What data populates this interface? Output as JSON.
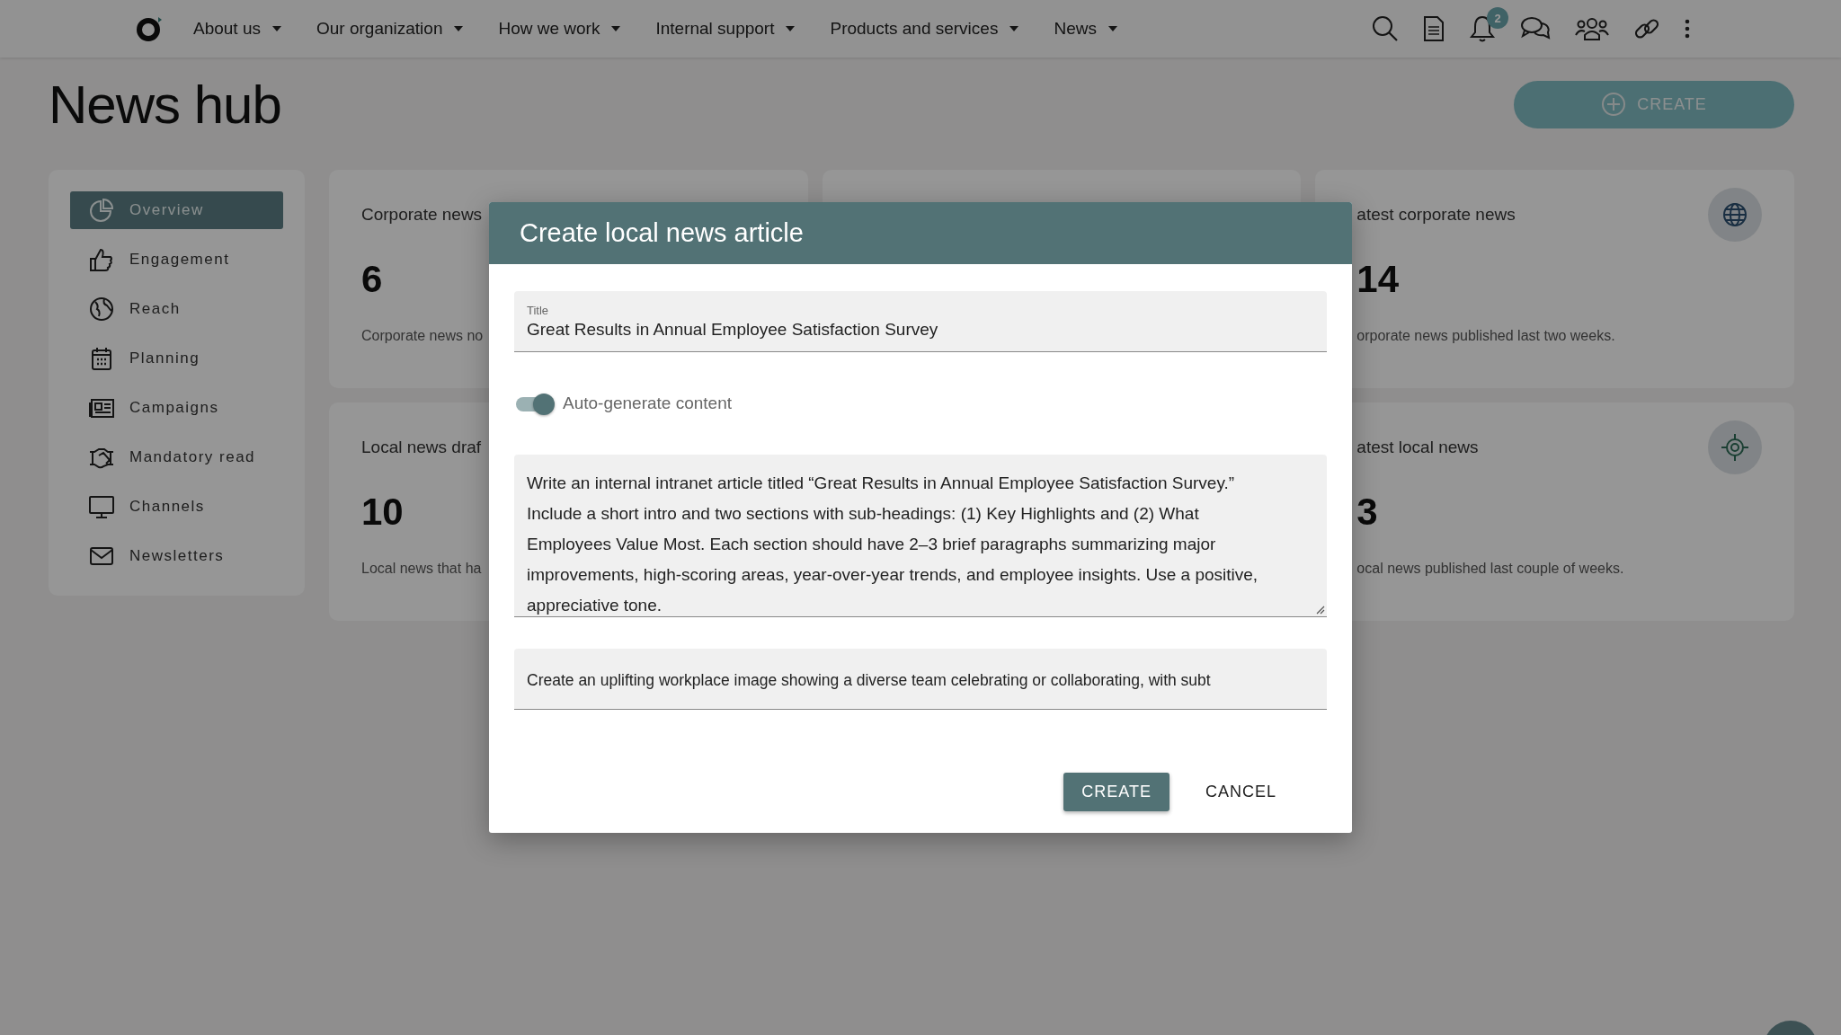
{
  "top_nav": {
    "menus": [
      {
        "label": "About us"
      },
      {
        "label": "Our organization"
      },
      {
        "label": "How we work"
      },
      {
        "label": "Internal support"
      },
      {
        "label": "Products and services"
      },
      {
        "label": "News"
      }
    ],
    "notification_count": "2"
  },
  "page_title": "News hub",
  "create_button": "CREATE",
  "sidebar": {
    "items": [
      {
        "label": "Overview",
        "selected": true
      },
      {
        "label": "Engagement",
        "selected": false
      },
      {
        "label": "Reach",
        "selected": false
      },
      {
        "label": "Planning",
        "selected": false
      },
      {
        "label": "Campaigns",
        "selected": false
      },
      {
        "label": "Mandatory read",
        "selected": false
      },
      {
        "label": "Channels",
        "selected": false
      },
      {
        "label": "Newsletters",
        "selected": false
      }
    ]
  },
  "cards": [
    {
      "kind": "left",
      "title": "Corporate news",
      "value": "6",
      "description": "Corporate news no"
    },
    {
      "kind": "blank"
    },
    {
      "kind": "right",
      "title": "atest corporate news",
      "value": "14",
      "description": "orporate news published last two weeks."
    },
    {
      "kind": "left",
      "title": "Local news draf",
      "value": "10",
      "description": "Local news that ha"
    },
    {
      "kind": "right",
      "title": "atest local news",
      "value": "3",
      "description": "ocal news published last couple of weeks."
    }
  ],
  "dialog": {
    "title": "Create local news article",
    "title_field": {
      "label": "Title",
      "value": "Great Results in Annual Employee Satisfaction Survey"
    },
    "auto_generate": {
      "label": "Auto-generate content",
      "on": true
    },
    "content_prompt": {
      "value": "Write an internal intranet article titled “Great Results in Annual Employee Satisfaction Survey.” Include a short intro and two sections with sub-headings: (1) Key Highlights and (2) What Employees Value Most. Each section should have 2–3 brief paragraphs summarizing major improvements, high-scoring areas, year-over-year trends, and employee insights. Use a positive, appreciative tone."
    },
    "image_prompt": {
      "value": "Create an uplifting workplace image showing a diverse team celebrating or collaborating, with subt"
    },
    "buttons": [
      {
        "label": "CREATE",
        "kind": "primary"
      },
      {
        "label": "CANCEL",
        "kind": "text"
      }
    ]
  }
}
